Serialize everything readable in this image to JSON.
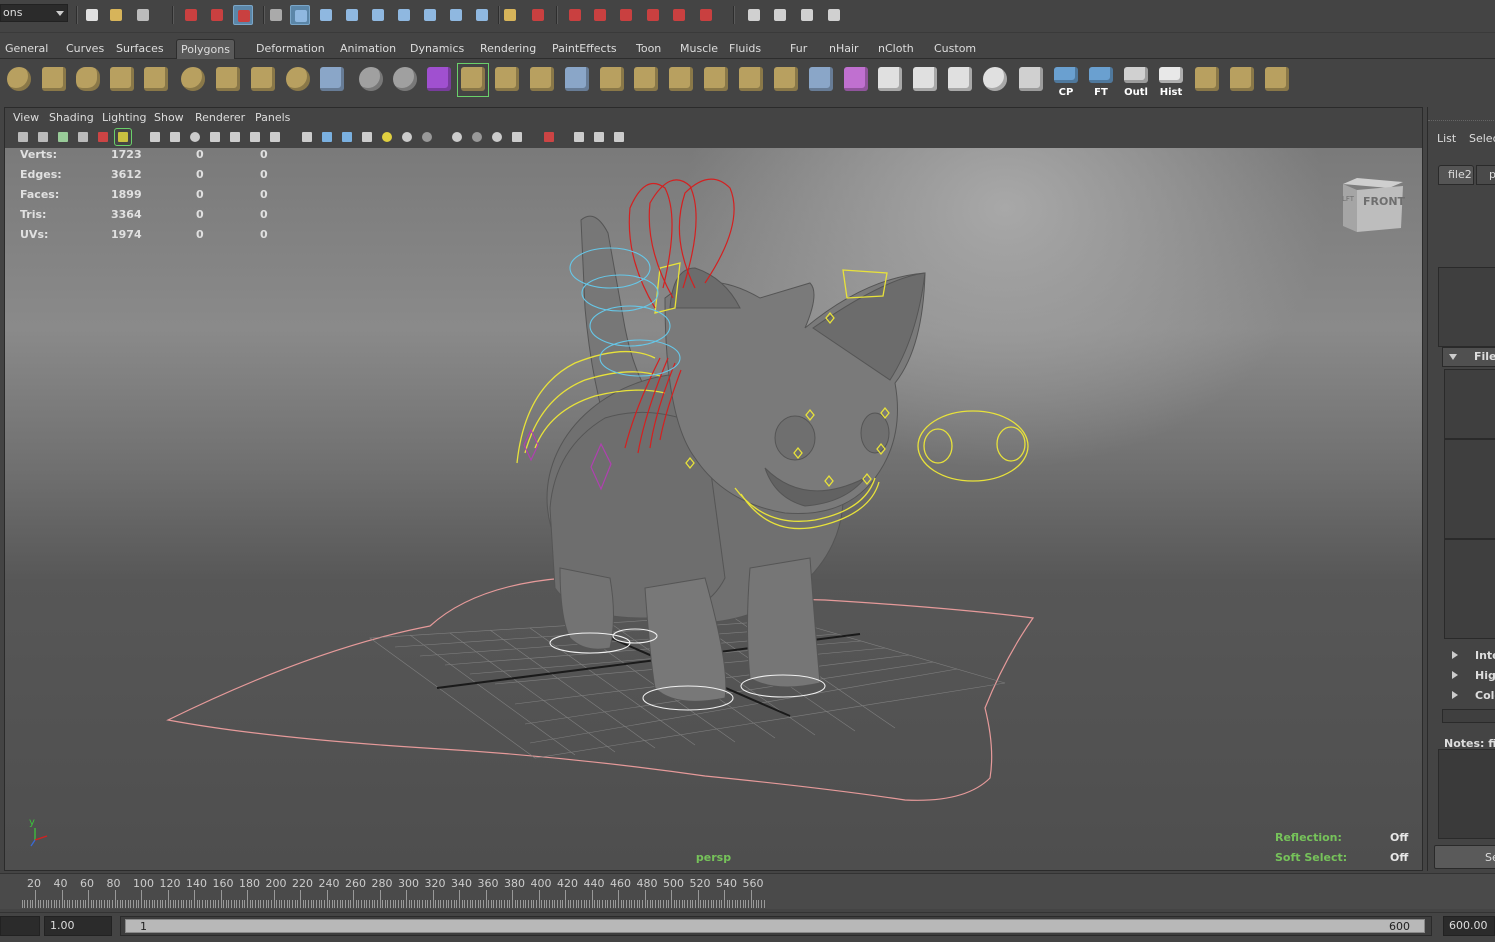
{
  "statusline": {
    "mode_value": "ons"
  },
  "shelf_tabs": [
    "General",
    "Curves",
    "Surfaces",
    "Polygons",
    "Deformation",
    "Animation",
    "Dynamics",
    "Rendering",
    "PaintEffects",
    "Toon",
    "Muscle",
    "Fluids",
    "Fur",
    "nHair",
    "nCloth",
    "Custom"
  ],
  "active_shelf_tab": "Polygons",
  "shelf_labels": {
    "cp": "CP",
    "ft": "FT",
    "outl": "Outl",
    "hist": "Hist"
  },
  "panel_menu": [
    "View",
    "Shading",
    "Lighting",
    "Show",
    "Renderer",
    "Panels"
  ],
  "hud": {
    "rows": [
      {
        "label": "Verts:",
        "v1": "1723",
        "v2": "0",
        "v3": "0"
      },
      {
        "label": "Edges:",
        "v1": "3612",
        "v2": "0",
        "v3": "0"
      },
      {
        "label": "Faces:",
        "v1": "1899",
        "v2": "0",
        "v3": "0"
      },
      {
        "label": "Tris:",
        "v1": "3364",
        "v2": "0",
        "v3": "0"
      },
      {
        "label": "UVs:",
        "v1": "1974",
        "v2": "0",
        "v3": "0"
      }
    ],
    "camera": "persp",
    "reflection_label": "Reflection:",
    "reflection_value": "Off",
    "soft_select_label": "Soft Select:",
    "soft_select_value": "Off",
    "viewcube_face": "FRONT",
    "viewcube_side": "LFT",
    "axis_y": "y"
  },
  "right_panel": {
    "list": "List",
    "select": "Selec",
    "tab1": "file2",
    "tab2": "p",
    "file_section": "File",
    "inte": "Inte",
    "high": "High",
    "colo": "Colo",
    "notes": "Notes: fil",
    "bottom_btn": "Se"
  },
  "time_slider": {
    "ticks": [
      "20",
      "40",
      "60",
      "80",
      "100",
      "120",
      "140",
      "160",
      "180",
      "200",
      "220",
      "240",
      "260",
      "280",
      "300",
      "320",
      "340",
      "360",
      "380",
      "400",
      "420",
      "440",
      "460",
      "480",
      "500",
      "520",
      "540",
      "560"
    ]
  },
  "range_slider": {
    "start_value": "1.00",
    "range_start": "1",
    "range_end": "600",
    "end_value": "600.00"
  },
  "colors": {
    "hud_green": "#76c35a",
    "control_red": "#d42020",
    "control_yellow": "#e8e23a",
    "control_cyan": "#66c7e8",
    "ground_curve": "#e69a9a"
  }
}
